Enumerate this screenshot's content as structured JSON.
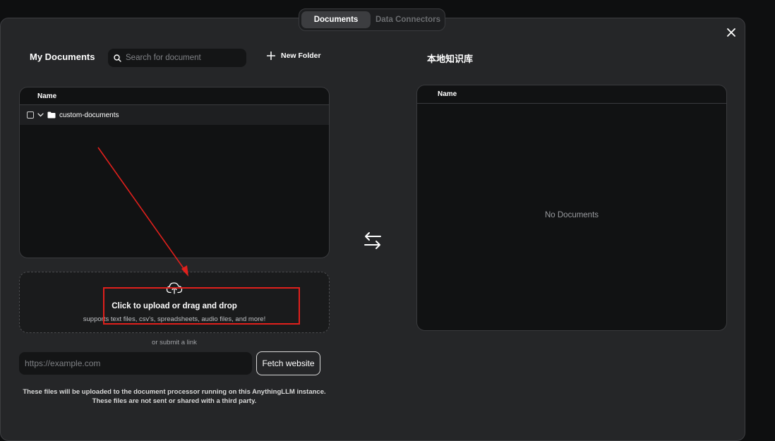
{
  "tabs": [
    {
      "label": "Documents",
      "active": true
    },
    {
      "label": "Data Connectors",
      "active": false
    }
  ],
  "left": {
    "title": "My Documents",
    "search_placeholder": "Search for document",
    "new_folder_label": "New Folder",
    "column_name": "Name",
    "folders": [
      {
        "name": "custom-documents",
        "expanded": true
      }
    ]
  },
  "upload": {
    "title": "Click to upload or drag and drop",
    "subtitle": "supports text files, csv's, spreadsheets, audio files, and more!",
    "or_link": "or submit a link",
    "url_placeholder": "https://example.com",
    "fetch_label": "Fetch website",
    "disclaimer_line1": "These files will be uploaded to the document processor running on this AnythingLLM instance.",
    "disclaimer_line2": "These files are not sent or shared with a third party."
  },
  "right": {
    "title": "本地知识库",
    "column_name": "Name",
    "empty_text": "No Documents"
  },
  "icons": {
    "close": "close-icon",
    "search": "search-icon",
    "plus": "plus-icon",
    "chevron": "chevron-down-icon",
    "folder": "folder-icon",
    "swap": "swap-arrows-icon",
    "upload": "cloud-upload-icon"
  },
  "colors": {
    "background": "#0e0f10",
    "modal": "#252628",
    "panel": "#111213",
    "annotation": "#e0201c"
  }
}
